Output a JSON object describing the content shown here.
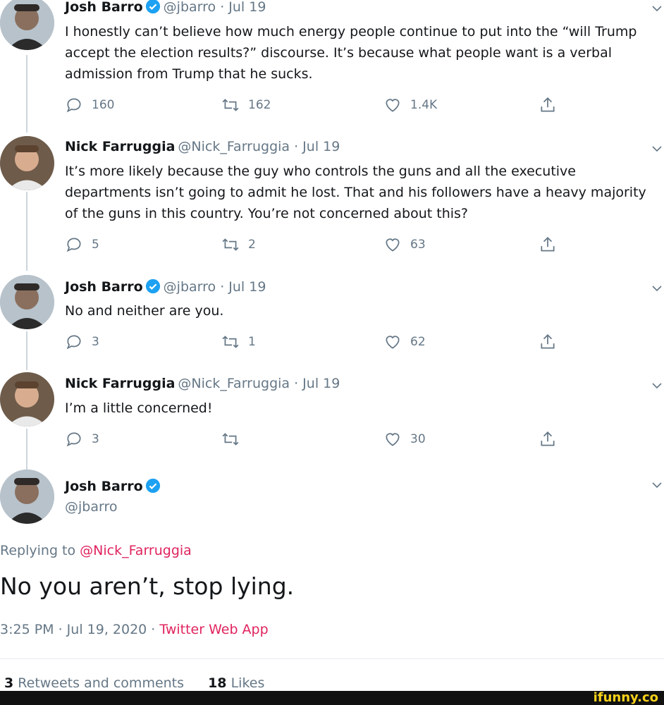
{
  "tweets": [
    {
      "name": "Josh Barro",
      "verified": true,
      "meta": "@jbarro · Jul 19",
      "text": "I honestly can’t believe how much energy people continue to put into the “will Trump accept the election results?” discourse. It’s because what people want is a verbal admission from Trump that he sucks.",
      "replies": "160",
      "retweets": "162",
      "likes": "1.4K"
    },
    {
      "name": "Nick Farruggia",
      "verified": false,
      "meta": "@Nick_Farruggia · Jul 19",
      "text": "It’s more likely because the guy who controls the guns and all the executive departments isn’t going to admit he lost. That and his followers have a heavy majority of the guns in this country. You’re not concerned about this?",
      "replies": "5",
      "retweets": "2",
      "likes": "63"
    },
    {
      "name": "Josh Barro",
      "verified": true,
      "meta": "@jbarro · Jul 19",
      "text": "No and neither are you.",
      "replies": "3",
      "retweets": "1",
      "likes": "62"
    },
    {
      "name": "Nick Farruggia",
      "verified": false,
      "meta": "@Nick_Farruggia · Jul 19",
      "text": "I’m a little concerned!",
      "replies": "3",
      "retweets": "",
      "likes": "30"
    }
  ],
  "main_tweet": {
    "name": "Josh Barro",
    "handle": "@jbarro",
    "replying_prefix": "Replying to",
    "replying_to": "@Nick_Farruggia",
    "text": "No you aren’t, stop lying.",
    "time_date": "3:25 PM · Jul 19, 2020 ·",
    "source": "Twitter Web App",
    "retweets_count": "3",
    "retweets_label": "Retweets and comments",
    "likes_count": "18",
    "likes_label": "Likes"
  },
  "watermark": "ifunny.co",
  "icons": {
    "reply": "reply-icon",
    "retweet": "retweet-icon",
    "like": "heart-icon",
    "share": "share-icon",
    "verified": "verified-badge-icon",
    "caret": "chevron-down-icon"
  },
  "colors": {
    "link": "#e0245e",
    "verified": "#1da1f2",
    "muted": "#657786",
    "thread_line": "#ccd6dd"
  }
}
